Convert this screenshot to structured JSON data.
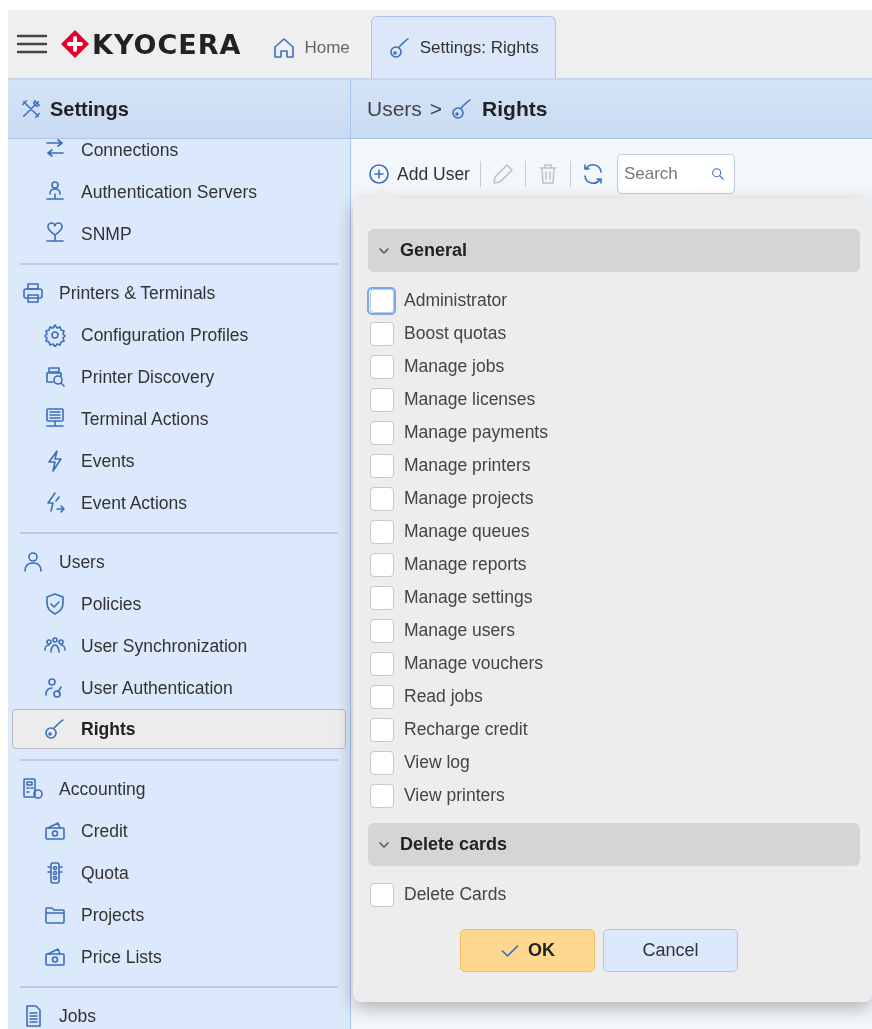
{
  "app": {
    "brand": "KYOCERA"
  },
  "tabs": [
    {
      "label": "Home",
      "selected": false
    },
    {
      "label": "Settings: Rights",
      "selected": true
    }
  ],
  "sidebar": {
    "title": "Settings",
    "sections": [
      {
        "items": [
          {
            "label": "Connections",
            "selected": false
          },
          {
            "label": "Authentication Servers",
            "selected": false
          },
          {
            "label": "SNMP",
            "selected": false
          }
        ]
      },
      {
        "title": "Printers & Terminals",
        "items": [
          {
            "label": "Configuration Profiles",
            "selected": false
          },
          {
            "label": "Printer Discovery",
            "selected": false
          },
          {
            "label": "Terminal Actions",
            "selected": false
          },
          {
            "label": "Events",
            "selected": false
          },
          {
            "label": "Event Actions",
            "selected": false
          }
        ]
      },
      {
        "title": "Users",
        "items": [
          {
            "label": "Policies",
            "selected": false
          },
          {
            "label": "User Synchronization",
            "selected": false
          },
          {
            "label": "User Authentication",
            "selected": false
          },
          {
            "label": "Rights",
            "selected": true
          }
        ]
      },
      {
        "title": "Accounting",
        "items": [
          {
            "label": "Credit",
            "selected": false
          },
          {
            "label": "Quota",
            "selected": false
          },
          {
            "label": "Projects",
            "selected": false
          },
          {
            "label": "Price Lists",
            "selected": false
          }
        ]
      },
      {
        "title": "Jobs"
      }
    ]
  },
  "breadcrumb": {
    "parent": "Users",
    "separator": ">",
    "current": "Rights"
  },
  "toolbar": {
    "buttons": [
      {
        "kind": "add",
        "label": "Add User",
        "disabled": false
      },
      {
        "kind": "edit",
        "disabled": true
      },
      {
        "kind": "delete",
        "disabled": true
      },
      {
        "kind": "refresh",
        "disabled": false
      }
    ],
    "search": {
      "placeholder": "Search"
    }
  },
  "popup": {
    "groups": [
      {
        "title": "General",
        "expanded": true,
        "rights": [
          {
            "label": "Administrator",
            "checked": false,
            "focused": true
          },
          {
            "label": "Boost quotas",
            "checked": false,
            "focused": false
          },
          {
            "label": "Manage jobs",
            "checked": false,
            "focused": false
          },
          {
            "label": "Manage licenses",
            "checked": false,
            "focused": false
          },
          {
            "label": "Manage payments",
            "checked": false,
            "focused": false
          },
          {
            "label": "Manage printers",
            "checked": false,
            "focused": false
          },
          {
            "label": "Manage projects",
            "checked": false,
            "focused": false
          },
          {
            "label": "Manage queues",
            "checked": false,
            "focused": false
          },
          {
            "label": "Manage reports",
            "checked": false,
            "focused": false
          },
          {
            "label": "Manage settings",
            "checked": false,
            "focused": false
          },
          {
            "label": "Manage users",
            "checked": false,
            "focused": false
          },
          {
            "label": "Manage vouchers",
            "checked": false,
            "focused": false
          },
          {
            "label": "Read jobs",
            "checked": false,
            "focused": false
          },
          {
            "label": "Recharge credit",
            "checked": false,
            "focused": false
          },
          {
            "label": "View log",
            "checked": false,
            "focused": false
          },
          {
            "label": "View printers",
            "checked": false,
            "focused": false
          }
        ]
      },
      {
        "title": "Delete cards",
        "expanded": true,
        "rights": [
          {
            "label": "Delete Cards",
            "checked": false,
            "focused": false
          }
        ]
      }
    ],
    "buttons": [
      {
        "kind": "primary",
        "label": "OK"
      },
      {
        "kind": "secondary",
        "label": "Cancel"
      }
    ]
  }
}
